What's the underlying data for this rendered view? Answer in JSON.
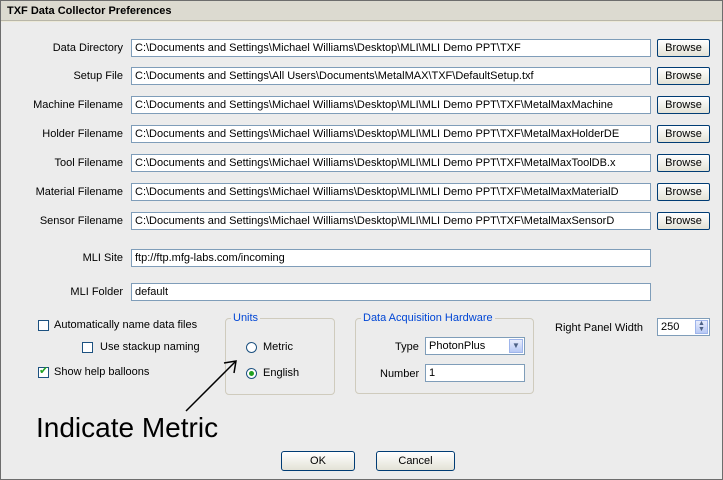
{
  "window": {
    "title": "TXF Data Collector Preferences"
  },
  "paths": [
    {
      "label": "Data Directory",
      "value": "C:\\Documents and Settings\\Michael Williams\\Desktop\\MLI\\MLI Demo PPT\\TXF"
    },
    {
      "label": "Setup File",
      "value": "C:\\Documents and Settings\\All Users\\Documents\\MetalMAX\\TXF\\DefaultSetup.txf"
    },
    {
      "label": "Machine Filename",
      "value": "C:\\Documents and Settings\\Michael Williams\\Desktop\\MLI\\MLI Demo PPT\\TXF\\MetalMaxMachine"
    },
    {
      "label": "Holder Filename",
      "value": "C:\\Documents and Settings\\Michael Williams\\Desktop\\MLI\\MLI Demo PPT\\TXF\\MetalMaxHolderDE"
    },
    {
      "label": "Tool Filename",
      "value": "C:\\Documents and Settings\\Michael Williams\\Desktop\\MLI\\MLI Demo PPT\\TXF\\MetalMaxToolDB.x"
    },
    {
      "label": "Material Filename",
      "value": "C:\\Documents and Settings\\Michael Williams\\Desktop\\MLI\\MLI Demo PPT\\TXF\\MetalMaxMaterialD"
    },
    {
      "label": "Sensor Filename",
      "value": "C:\\Documents and Settings\\Michael Williams\\Desktop\\MLI\\MLI Demo PPT\\TXF\\MetalMaxSensorD"
    }
  ],
  "browse_label": "Browse",
  "mli_site": {
    "label": "MLI Site",
    "value": "ftp://ftp.mfg-labs.com/incoming"
  },
  "mli_folder": {
    "label": "MLI Folder",
    "value": "default"
  },
  "options": {
    "auto_name": {
      "label": "Automatically name data files",
      "checked": false
    },
    "stackup": {
      "label": "Use stackup naming",
      "checked": false
    },
    "help_balloons": {
      "label": "Show help balloons",
      "checked": true
    }
  },
  "units": {
    "title": "Units",
    "metric": {
      "label": "Metric",
      "selected": false
    },
    "english": {
      "label": "English",
      "selected": true
    }
  },
  "daq": {
    "title": "Data Acquisition Hardware",
    "type_label": "Type",
    "type_value": "PhotonPlus",
    "number_label": "Number",
    "number_value": "1"
  },
  "right_panel": {
    "label": "Right Panel Width",
    "value": "250"
  },
  "buttons": {
    "ok": "OK",
    "cancel": "Cancel"
  },
  "annotation": {
    "text": "Indicate Metric"
  }
}
